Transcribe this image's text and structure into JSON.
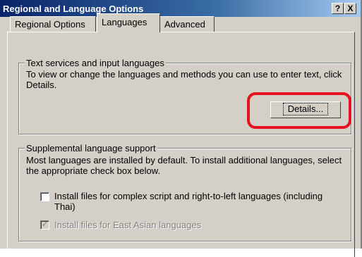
{
  "window": {
    "title": "Regional and Language Options",
    "help_btn": "?",
    "close_btn": "X"
  },
  "tabs": [
    {
      "label": "Regional Options",
      "active": false
    },
    {
      "label": "Languages",
      "active": true
    },
    {
      "label": "Advanced",
      "active": false
    }
  ],
  "text_services": {
    "title": "Text services and input languages",
    "description": "To view or change the languages and methods you can use to enter text, click Details.",
    "details_button": "Details..."
  },
  "supplemental": {
    "title": "Supplemental language support",
    "description": "Most languages are installed by default. To install additional languages, select the appropriate check box below.",
    "complex_script": {
      "label": "Install files for complex script and right-to-left languages (including Thai)",
      "checked": false,
      "enabled": true
    },
    "east_asian": {
      "label": "Install files for East Asian languages",
      "checked": true,
      "enabled": false
    }
  },
  "colors": {
    "highlight": "#e8121e",
    "titlebar": "#0a246a",
    "face": "#d4d0c8"
  }
}
